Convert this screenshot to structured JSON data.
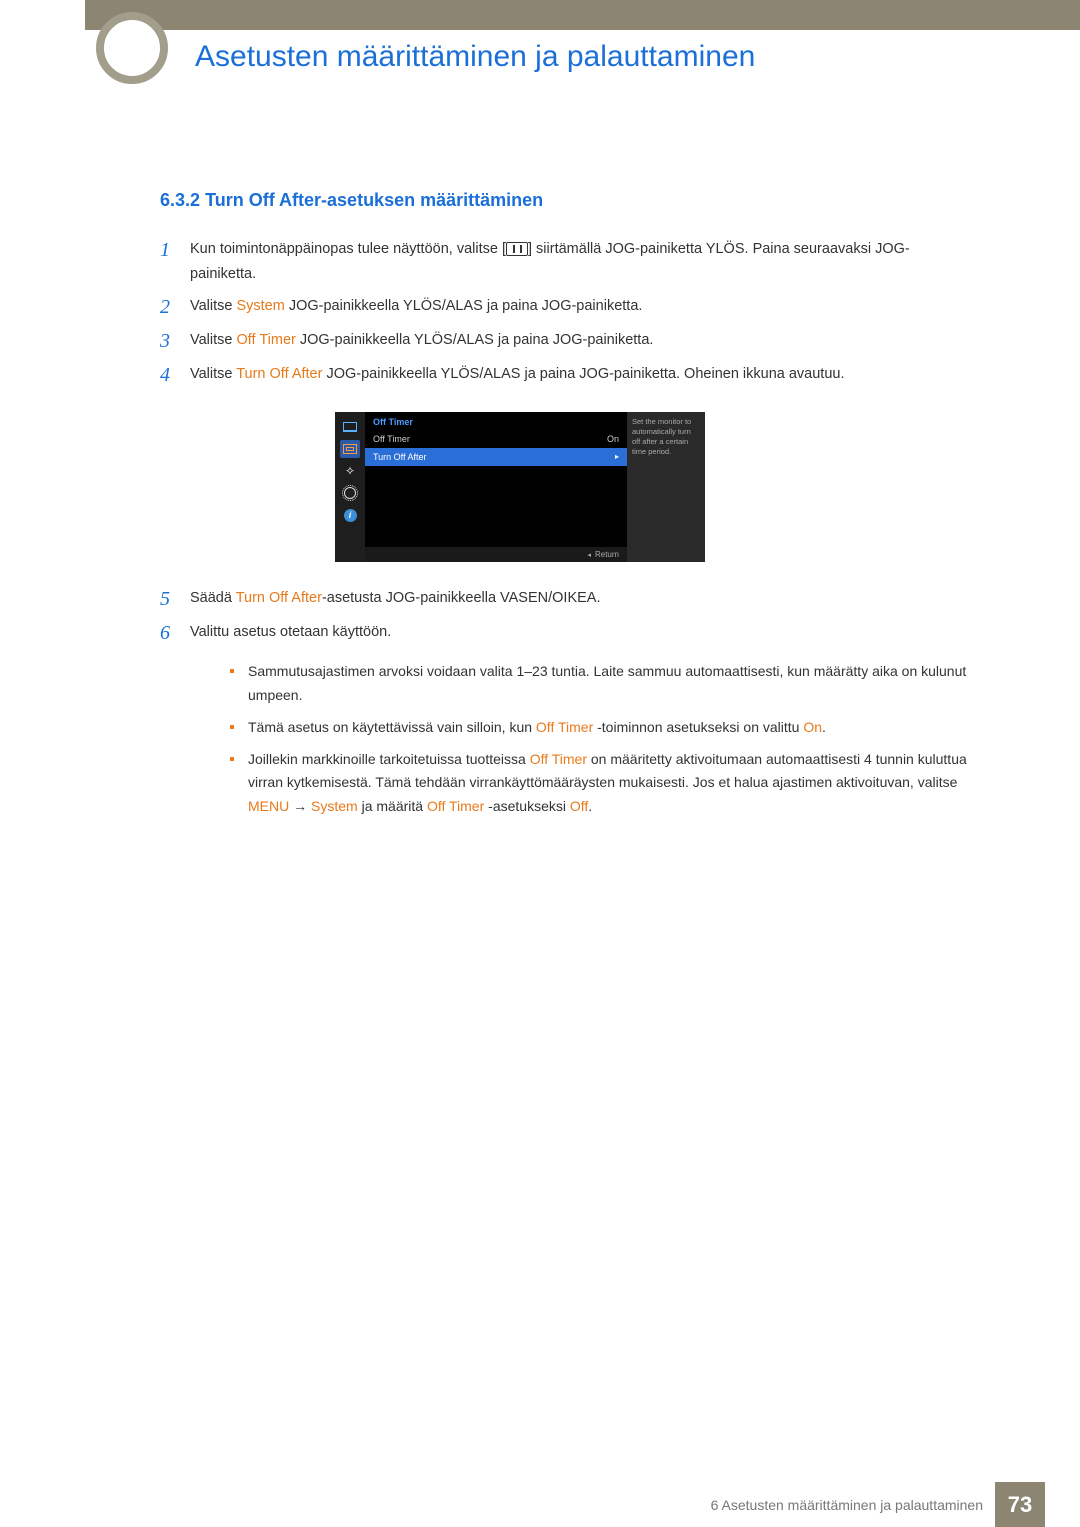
{
  "header": {
    "page_title": "Asetusten määrittäminen ja palauttaminen"
  },
  "section": {
    "number": "6.3.2",
    "title": "Turn Off After-asetuksen määrittäminen"
  },
  "steps": {
    "s1a": "Kun toimintonäppäinopas tulee näyttöön, valitse [",
    "s1b": "] siirtämällä JOG-painiketta YLÖS. Paina seuraavaksi JOG-painiketta.",
    "s2a": "Valitse ",
    "s2_system": "System",
    "s2b": " JOG-painikkeella YLÖS/ALAS ja paina JOG-painiketta.",
    "s3a": "Valitse ",
    "s3_offtimer": "Off Timer",
    "s3b": " JOG-painikkeella YLÖS/ALAS ja paina JOG-painiketta.",
    "s4a": "Valitse ",
    "s4_toa": "Turn Off After",
    "s4b": " JOG-painikkeella YLÖS/ALAS ja paina JOG-painiketta. Oheinen ikkuna avautuu.",
    "s5a": "Säädä ",
    "s5_toa": "Turn Off After",
    "s5b": "-asetusta JOG-painikkeella VASEN/OIKEA.",
    "s6": "Valittu asetus otetaan käyttöön."
  },
  "step_numbers": {
    "n1": "1",
    "n2": "2",
    "n3": "3",
    "n4": "4",
    "n5": "5",
    "n6": "6"
  },
  "osd": {
    "title": "Off Timer",
    "row1_label": "Off Timer",
    "row1_value": "On",
    "row2_label": "Turn Off After",
    "desc": "Set the monitor to automatically turn off after a certain time period.",
    "return": "Return",
    "info_glyph": "i"
  },
  "notes": {
    "n1": "Sammutusajastimen arvoksi voidaan valita 1–23 tuntia. Laite sammuu automaattisesti, kun määrätty aika on kulunut umpeen.",
    "n2a": "Tämä asetus on käytettävissä vain silloin, kun ",
    "n2_offtimer": "Off Timer",
    "n2b": " -toiminnon asetukseksi on valittu ",
    "n2_on": "On",
    "n2c": ".",
    "n3a": "Joillekin markkinoille tarkoitetuissa tuotteissa ",
    "n3_offtimer": "Off Timer",
    "n3b": " on määritetty aktivoitumaan automaattisesti 4 tunnin kuluttua virran kytkemisestä. Tämä tehdään virrankäyttömääräysten mukaisesti. Jos et halua ajastimen aktivoituvan, valitse ",
    "n3_menu": "MENU",
    "n3_arrow": " → ",
    "n3_system": "System",
    "n3c": " ja määritä ",
    "n3_offtimer2": "Off Timer",
    "n3d": " -asetukseksi ",
    "n3_off": "Off",
    "n3e": "."
  },
  "footer": {
    "chapter": "6 Asetusten määrittäminen ja palauttaminen",
    "page": "73"
  }
}
